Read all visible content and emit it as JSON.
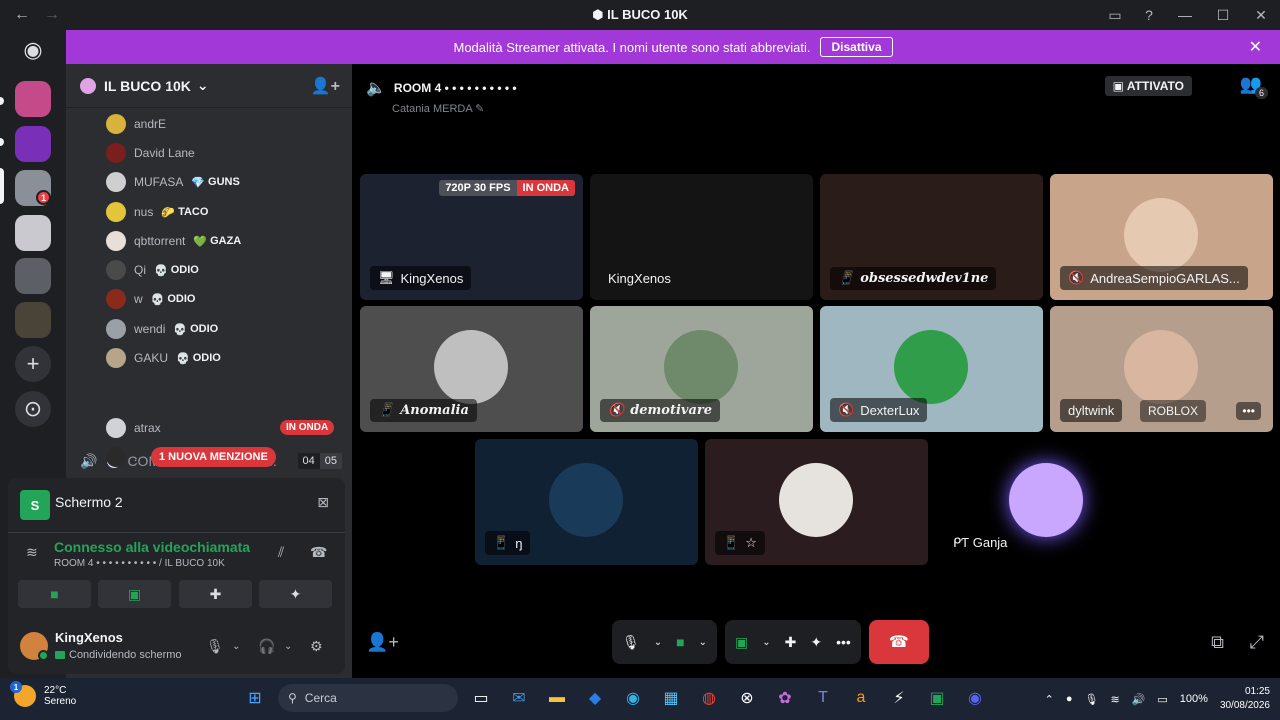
{
  "window": {
    "title": "IL BUCO 10K",
    "back": "←",
    "forward": "→"
  },
  "banner": {
    "text": "Modalità Streamer attivata. I nomi utente sono stati abbreviati.",
    "button": "Disattiva"
  },
  "servers": {
    "badge": "1"
  },
  "guild": {
    "name": "IL BUCO 10K",
    "chevron": "⌄"
  },
  "voice_users": [
    {
      "name": "andrE",
      "tag": "",
      "color": "#d9b23b"
    },
    {
      "name": "David Lane",
      "tag": "",
      "color": "#7a1e1e"
    },
    {
      "name": "MUFASA",
      "tag": "GUNS",
      "tag_icon": "💎",
      "color": "#cfcfcf"
    },
    {
      "name": "nus",
      "tag": "TACO",
      "tag_icon": "🌮",
      "color": "#e3c53a"
    },
    {
      "name": "qbttorrent",
      "tag": "GAZA",
      "tag_icon": "💚",
      "color": "#e8e0d8"
    },
    {
      "name": "Qi",
      "tag": "ODIO",
      "tag_icon": "💀",
      "color": "#4a4a4a"
    },
    {
      "name": "w",
      "tag": "ODIO",
      "tag_icon": "💀",
      "color": "#8a2a1a"
    },
    {
      "name": "wendi",
      "tag": "ODIO",
      "tag_icon": "💀",
      "color": "#9aa0a6"
    },
    {
      "name": "GAKU",
      "tag": "ODIO",
      "tag_icon": "💀",
      "color": "#b7a58a"
    }
  ],
  "voice_channel2": {
    "name": "COME VENDERE DR...",
    "count_a": "04",
    "count_b": "05"
  },
  "second_users": [
    {
      "name": "atrax",
      "color": "#cfd2d6"
    },
    {
      "name": ".",
      "color": "#2a2a2a"
    }
  ],
  "live_label": "IN ONDA",
  "mention_label": "1 NUOVA MENZIONE",
  "panel": {
    "stream_name": "Schermo 2",
    "stream_letter": "S",
    "connected": "Connesso alla videochiamata",
    "connected_sub": "ROOM 4 • • • • • • • • • • / IL BUCO 10K",
    "user": "KingXenos",
    "user_status": "Condividendo schermo"
  },
  "stage": {
    "room": "ROOM 4 • • • • • • • • • •",
    "topic": "Catania MERDA",
    "activated": "ATTIVATO",
    "participants": "6"
  },
  "tiles": [
    {
      "name": "KingXenos",
      "icon": "🖥",
      "quality": "720P 30 FPS",
      "live": "IN ONDA",
      "bg": "#1c2230"
    },
    {
      "name": "KingXenos",
      "icon": "",
      "bg": "#141414"
    },
    {
      "name": "obsessedwdev1ne",
      "icon": "📱",
      "bg": "#2a1c18"
    },
    {
      "name": "AndreaSempioGARLAS...",
      "icon": "🔇",
      "bg": "#c8a58a"
    },
    {
      "name": "Anomalia",
      "icon": "📱",
      "bg": "#4e4e4e"
    },
    {
      "name": "demotivare",
      "icon": "🔇",
      "bg": "#9ea69c"
    },
    {
      "name": "DexterLux",
      "icon": "🔇",
      "bg": "#9eb7c0"
    },
    {
      "name": "dyltwink",
      "icon": "",
      "activity": "ROBLOX",
      "bg": "#b59f8c"
    },
    {
      "name": "ŋ",
      "icon": "📱",
      "bg": "#102134"
    },
    {
      "name": "☆",
      "icon": "📱",
      "bg": "#2b1c1f"
    },
    {
      "name": "ᑭƬ Ganja",
      "icon": "",
      "bg": "#000000"
    }
  ],
  "taskbar": {
    "temp": "22°C",
    "weather": "Sereno",
    "weather_badge": "1",
    "search_placeholder": "Cerca",
    "battery": "100%",
    "time": "01:25",
    "date": "30/08/2026"
  }
}
